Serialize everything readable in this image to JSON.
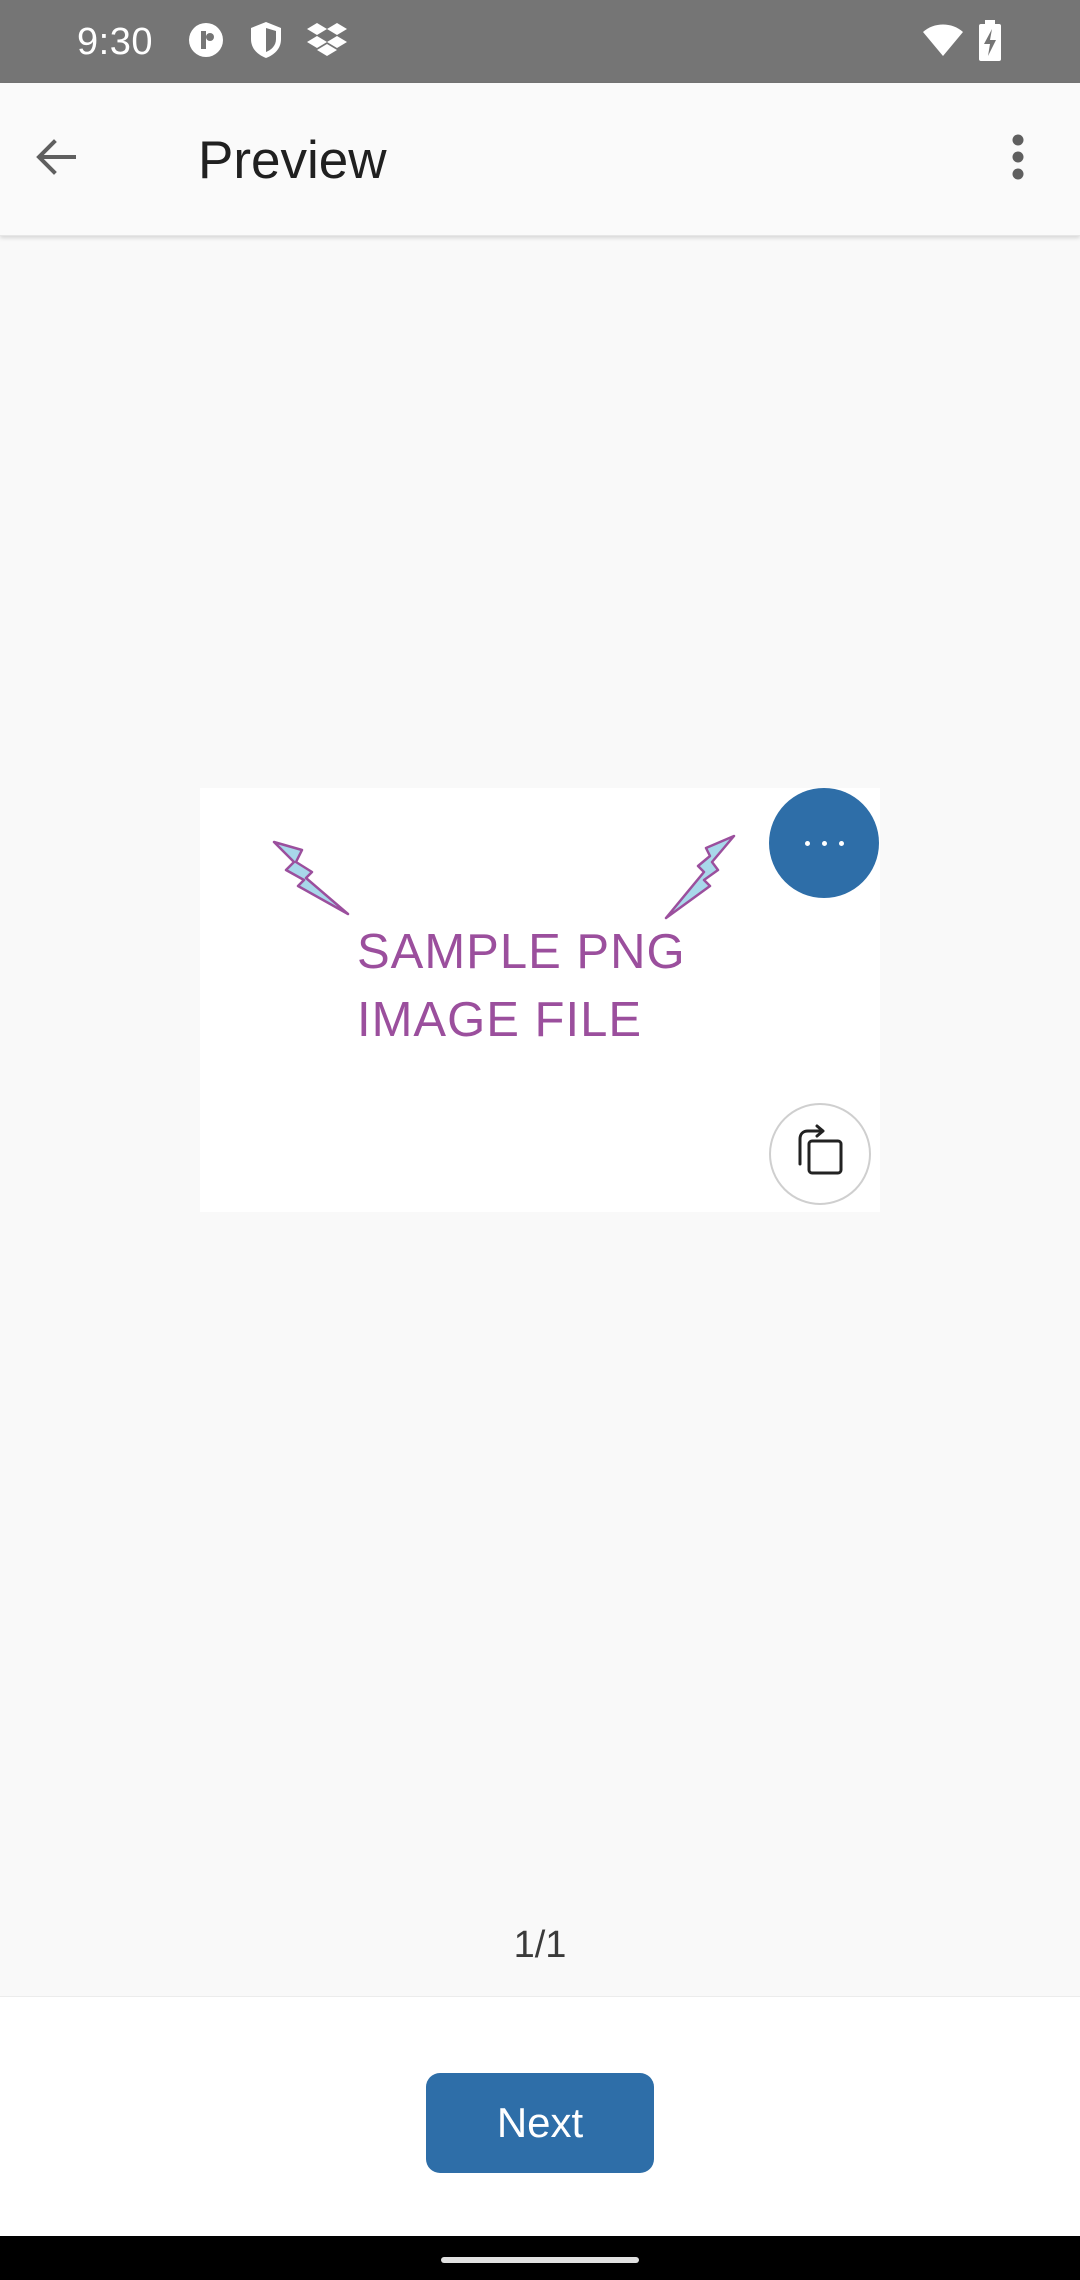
{
  "status_bar": {
    "time": "9:30",
    "icons_left": [
      "p-circle-icon",
      "shield-icon",
      "dropbox-icon"
    ],
    "icons_right": [
      "wifi-icon",
      "battery-charging-icon"
    ]
  },
  "app_bar": {
    "title": "Preview",
    "back_icon": "arrow-back-icon",
    "more_icon": "more-vert-icon"
  },
  "preview": {
    "image_text_line1": "SAMPLE PNG",
    "image_text_line2": "IMAGE FILE",
    "image_text_color": "#9b4f9d",
    "bolt_color": "#a8d8ea",
    "options_icon": "more-horiz-icon",
    "rotate_icon": "rotate-icon"
  },
  "page_indicator": "1/1",
  "actions": {
    "next_label": "Next"
  },
  "colors": {
    "accent": "#2e6ea8",
    "status_bar": "#757575",
    "background": "#f9f9f9"
  }
}
